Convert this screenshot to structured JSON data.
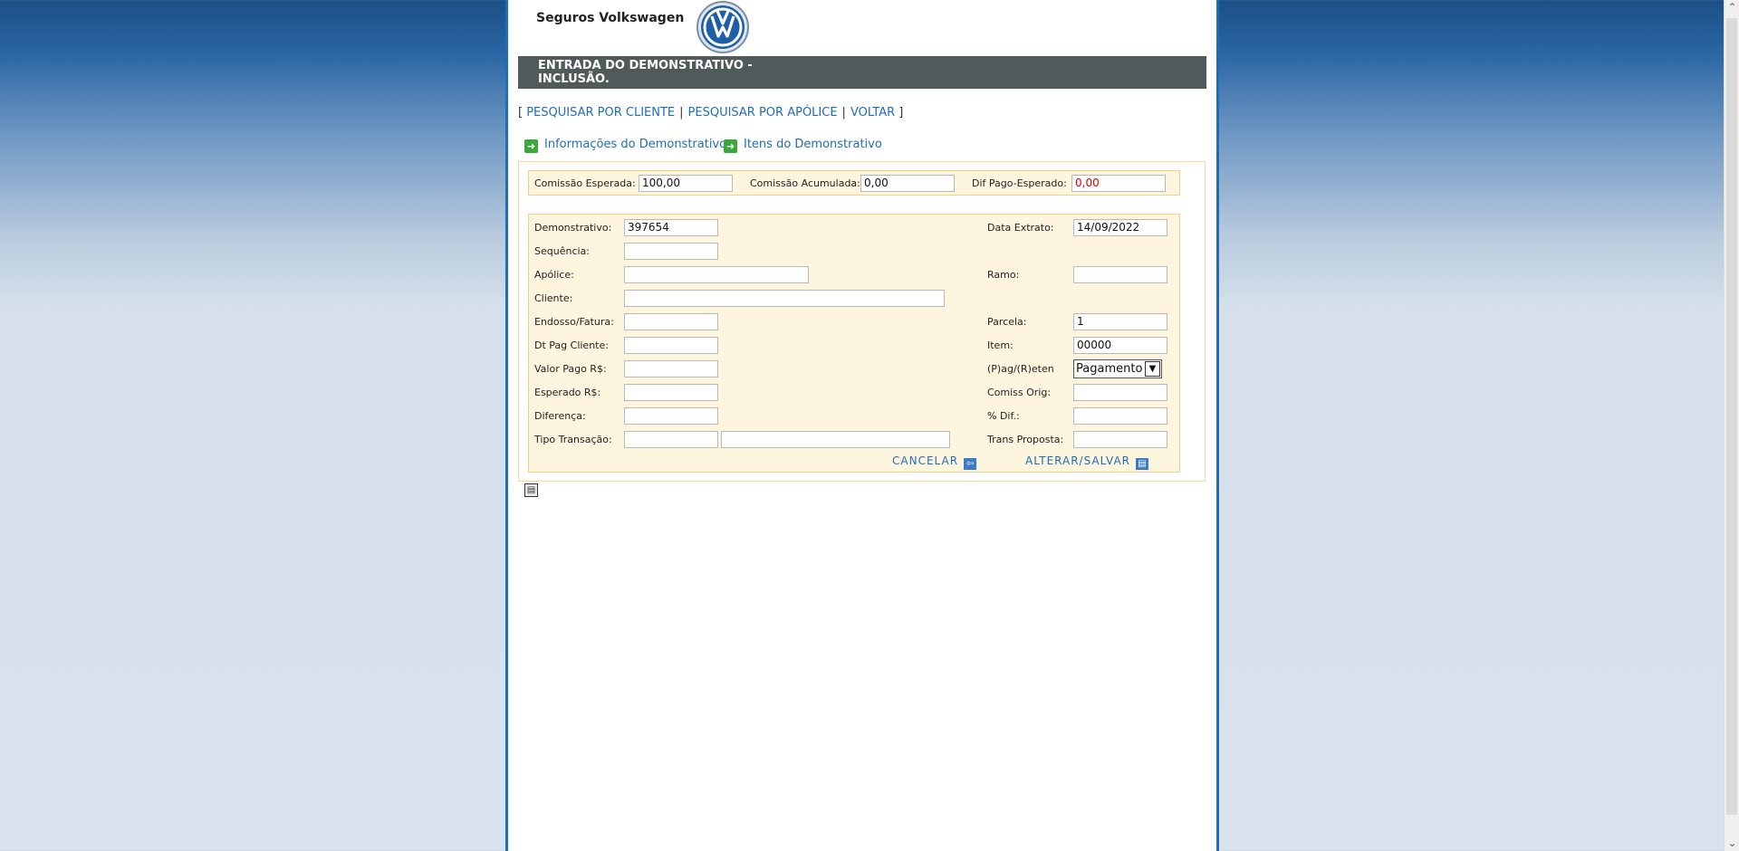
{
  "header": {
    "brand": "Seguros Volkswagen",
    "title_line1": "ENTRADA DO DEMONSTRATIVO -",
    "title_line2": "INCLUSÃO."
  },
  "nav": {
    "open_bracket": "[",
    "close_bracket": "]",
    "separator": "|",
    "links": [
      "PESQUISAR POR CLIENTE",
      "PESQUISAR POR APÓLICE",
      "VOLTAR"
    ]
  },
  "tabs": [
    "Informações do Demonstrativo",
    "Itens do Demonstrativo"
  ],
  "summary": {
    "comissao_esperada": {
      "label": "Comissão Esperada:",
      "value": "100,00"
    },
    "comissao_acumulada": {
      "label": "Comissão Acumulada:",
      "value": "0,00"
    },
    "dif_pago_esperado": {
      "label": "Dif Pago-Esperado:",
      "value": "0,00"
    }
  },
  "form": {
    "demonstrativo": {
      "label": "Demonstrativo:",
      "value": "397654"
    },
    "sequencia": {
      "label": "Sequência:",
      "value": ""
    },
    "apolice": {
      "label": "Apólice:",
      "value": ""
    },
    "cliente": {
      "label": "Cliente:",
      "value": ""
    },
    "endosso": {
      "label": "Endosso/Fatura:",
      "value": ""
    },
    "dt_pag_cliente": {
      "label": "Dt Pag Cliente:",
      "value": ""
    },
    "valor_pago": {
      "label": "Valor Pago R$:",
      "value": ""
    },
    "esperado": {
      "label": "Esperado R$:",
      "value": ""
    },
    "diferenca": {
      "label": "Diferença:",
      "value": ""
    },
    "tipo_transacao": {
      "label": "Tipo Transação:",
      "code": "",
      "description": ""
    },
    "data_extrato": {
      "label": "Data Extrato:",
      "value": "14/09/2022"
    },
    "ramo": {
      "label": "Ramo:",
      "value": ""
    },
    "parcela": {
      "label": "Parcela:",
      "value": "1"
    },
    "item": {
      "label": "Item:",
      "value": "00000"
    },
    "pag_reten": {
      "label": "(P)ag/(R)eten",
      "selected": "Pagamento"
    },
    "comiss_orig": {
      "label": "Comiss Orig:",
      "value": ""
    },
    "pct_dif": {
      "label": "% Dif.:",
      "value": ""
    },
    "trans_proposta": {
      "label": "Trans Proposta:",
      "value": ""
    }
  },
  "actions": {
    "cancel": "CANCELAR",
    "save": "ALTERAR/SALVAR"
  },
  "colors": {
    "link": "#1f6db8",
    "title_bg": "#515a5a",
    "panel_bg": "#fdf5dd",
    "negative": "#d90000"
  },
  "icons": [
    "vw-logo",
    "arrow-right-icon",
    "arrow-left-icon",
    "floppy-disk-icon",
    "scroll-up-icon",
    "scroll-down-icon"
  ]
}
